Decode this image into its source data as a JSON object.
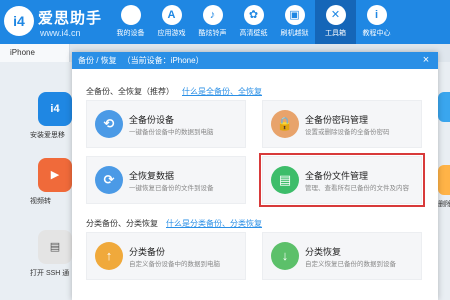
{
  "app": {
    "logo_glyph": "i4",
    "brand_name": "爱思助手",
    "brand_url": "www.i4.cn",
    "accent_color": "#1f87e3"
  },
  "nav": {
    "items": [
      {
        "label": "我的设备",
        "icon": "apple-icon",
        "glyph": ""
      },
      {
        "label": "应用游戏",
        "icon": "app-store-icon",
        "glyph": "A"
      },
      {
        "label": "酷炫铃声",
        "icon": "bell-icon",
        "glyph": "♪"
      },
      {
        "label": "高清壁纸",
        "icon": "flower-icon",
        "glyph": "✿"
      },
      {
        "label": "刷机越狱",
        "icon": "box-icon",
        "glyph": "▣"
      },
      {
        "label": "工具箱",
        "icon": "tools-icon",
        "glyph": "✕"
      },
      {
        "label": "教程中心",
        "icon": "info-icon",
        "glyph": "i"
      }
    ],
    "active_index": 5
  },
  "device_tab": {
    "label": "iPhone"
  },
  "background_apps": {
    "left": [
      {
        "label": "安装爱思移",
        "glyph": "i4",
        "color": "#1f87e3"
      },
      {
        "label": "视频转",
        "glyph": "▶",
        "color": "#f06a3a"
      },
      {
        "label": "打开 SSH 通",
        "glyph": "▤",
        "color": "#e4e4e4"
      }
    ],
    "right": [
      {
        "label": "",
        "color": "#3aa6ee"
      },
      {
        "label": "删除",
        "color": "#ffb347"
      }
    ]
  },
  "modal": {
    "title": "备份 / 恢复",
    "device_label": "（当前设备：iPhone）",
    "close_glyph": "×",
    "section1": {
      "title": "全备份、全恢复（推荐）",
      "link": "什么是全备份、全恢复"
    },
    "section2": {
      "title": "分类备份、分类恢复",
      "link": "什么是分类备份、分类恢复"
    },
    "cards": [
      {
        "title": "全备份设备",
        "desc": "一键备份设备中的数据到电脑",
        "glyph": "⟲",
        "color": "#4b9ae6"
      },
      {
        "title": "全备份密码管理",
        "desc": "设置或删除设备的全备份密码",
        "glyph": "🔒",
        "color": "#e8a36b"
      },
      {
        "title": "全恢复数据",
        "desc": "一键恢复已备份的文件到设备",
        "glyph": "⟳",
        "color": "#4b9ae6"
      },
      {
        "title": "全备份文件管理",
        "desc": "管理、查看所有已备份的文件及内容",
        "glyph": "▤",
        "color": "#3dbd6a"
      },
      {
        "title": "分类备份",
        "desc": "自定义备份设备中的数据到电脑",
        "glyph": "↑",
        "color": "#f0a93b"
      },
      {
        "title": "分类恢复",
        "desc": "自定义恢复已备份的数据到设备",
        "glyph": "↓",
        "color": "#5cc06a"
      }
    ]
  }
}
